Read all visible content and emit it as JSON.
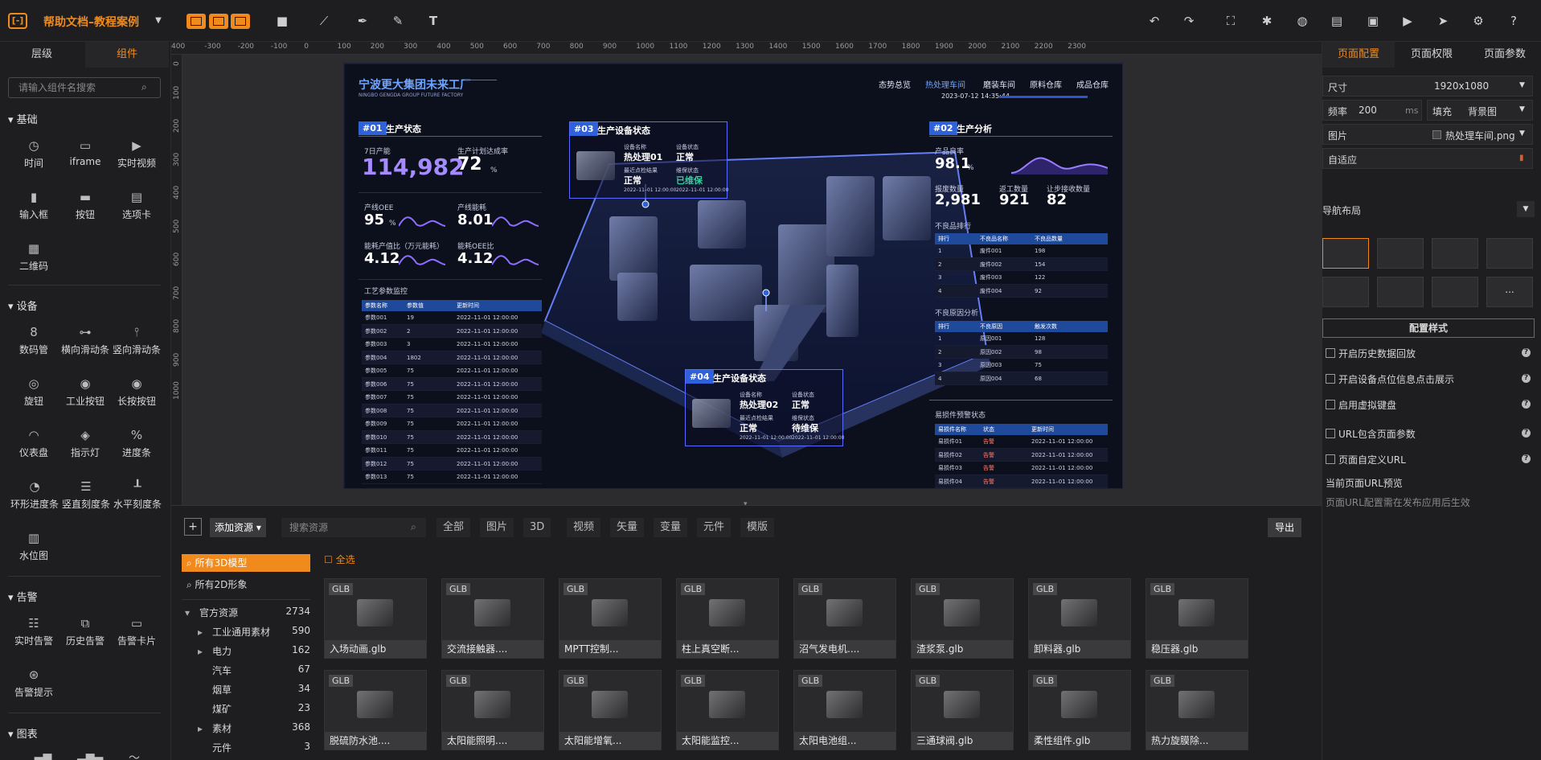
{
  "app": {
    "title": "帮助文档–教程案例",
    "logo_glyph": "[-]"
  },
  "toolbar": {
    "left_icons": [
      "layout-left-icon",
      "layout-center-icon",
      "layout-bottom-icon",
      "rectangle-tool-icon",
      "line-tool-icon",
      "pen-tool-icon",
      "brush-tool-icon",
      "text-tool-icon"
    ],
    "right_icons": [
      "undo-icon",
      "redo-icon",
      "fullscreen-icon",
      "bug-icon",
      "globe-icon",
      "document-icon",
      "save-icon",
      "play-icon",
      "send-icon",
      "gear-icon",
      "help-icon"
    ]
  },
  "left_panel": {
    "tabs": [
      "层级",
      "组件"
    ],
    "search_placeholder": "请输入组件名搜索",
    "sections": [
      {
        "title": "基础",
        "items": [
          "时间",
          "iframe",
          "实时视频",
          "输入框",
          "按钮",
          "选项卡",
          "二维码"
        ]
      },
      {
        "title": "设备",
        "items": [
          "数码管",
          "横向滑动条",
          "竖向滑动条",
          "旋钮",
          "工业按钮",
          "长按按钮",
          "仪表盘",
          "指示灯",
          "进度条",
          "环形进度条",
          "竖直刻度条",
          "水平刻度条",
          "水位图"
        ]
      },
      {
        "title": "告警",
        "items": [
          "实时告警",
          "历史告警",
          "告警卡片",
          "告警提示"
        ]
      },
      {
        "title": "图表",
        "items": []
      }
    ]
  },
  "ruler": {
    "h_labels": [
      "400",
      "-300",
      "-200",
      "-100",
      "0",
      "100",
      "200",
      "300",
      "400",
      "500",
      "600",
      "700",
      "800",
      "900",
      "1000",
      "1100",
      "1200",
      "1300",
      "1400",
      "1500",
      "1600",
      "1700",
      "1800",
      "1900",
      "2000",
      "2100",
      "2200",
      "2300"
    ],
    "v_labels": [
      "0",
      "100",
      "200",
      "300",
      "400",
      "500",
      "600",
      "700",
      "800",
      "900",
      "1000"
    ]
  },
  "dashboard": {
    "title": "宁波更大集团未来工厂",
    "subtitle": "NINGBO GENGDA GROUP FUTURE FACTORY",
    "nav": [
      "态势总览",
      "热处理车间",
      "磨装车间",
      "原料仓库",
      "成品仓库"
    ],
    "datetime": "2023-07-12 14:35:44",
    "p01": {
      "badge": "#01",
      "title": "生产状态",
      "kpi1_label": "7日产能",
      "kpi1_value": "114,982",
      "kpi2_label": "生产计划达成率",
      "kpi2_value": "72",
      "kpi2_unit": "%",
      "m1_label": "产线OEE",
      "m1_value": "95",
      "m1_unit": "%",
      "m2_label": "产线能耗",
      "m2_value": "8.01",
      "m3_label": "能耗产值比（万元能耗）",
      "m3_value": "4.12",
      "m4_label": "能耗OEE比",
      "m4_value": "4.12",
      "table_title": "工艺参数监控",
      "table_headers": [
        "参数名称",
        "参数值",
        "更新时间"
      ],
      "table_rows": [
        [
          "参数001",
          "19",
          "2022–11–01 12:00:00"
        ],
        [
          "参数002",
          "2",
          "2022–11–01 12:00:00"
        ],
        [
          "参数003",
          "3",
          "2022–11–01 12:00:00"
        ],
        [
          "参数004",
          "1802",
          "2022–11–01 12:00:00"
        ],
        [
          "参数005",
          "75",
          "2022–11–01 12:00:00"
        ],
        [
          "参数006",
          "75",
          "2022–11–01 12:00:00"
        ],
        [
          "参数007",
          "75",
          "2022–11–01 12:00:00"
        ],
        [
          "参数008",
          "75",
          "2022–11–01 12:00:00"
        ],
        [
          "参数009",
          "75",
          "2022–11–01 12:00:00"
        ],
        [
          "参数010",
          "75",
          "2022–11–01 12:00:00"
        ],
        [
          "参数011",
          "75",
          "2022–11–01 12:00:00"
        ],
        [
          "参数012",
          "75",
          "2022–11–01 12:00:00"
        ],
        [
          "参数013",
          "75",
          "2022–11–01 12:00:00"
        ]
      ]
    },
    "p03": {
      "badge": "#03",
      "title": "生产设备状态",
      "name_label": "设备名称",
      "name_value": "热处理01",
      "status_label": "设备状态",
      "status_value": "正常",
      "check_label": "最近点检结果",
      "check_value": "正常",
      "maint_label": "维保状态",
      "maint_value": "已维保",
      "time1": "2022–11–01 12:00:00",
      "time2": "2022–11–01 12:00:00"
    },
    "p04": {
      "badge": "#04",
      "title": "生产设备状态",
      "name_label": "设备名称",
      "name_value": "热处理02",
      "status_label": "设备状态",
      "status_value": "正常",
      "check_label": "最近点检结果",
      "check_value": "正常",
      "maint_label": "维保状态",
      "maint_value": "待维保",
      "time1": "2022–11–01 12:00:00",
      "time2": "2022–11–01 12:00:00"
    },
    "p02": {
      "badge": "#02",
      "title": "生产分析",
      "rate_label": "产品良率",
      "rate_value": "98.1",
      "rate_unit": "%",
      "c1_label": "报废数量",
      "c1_value": "2,981",
      "c2_label": "返工数量",
      "c2_value": "921",
      "c3_label": "让步接收数量",
      "c3_value": "82",
      "rank_title": "不良品排行",
      "rank_headers": [
        "排行",
        "不良品名称",
        "不良品数量"
      ],
      "rank_rows": [
        [
          "1",
          "废件001",
          "198"
        ],
        [
          "2",
          "废件002",
          "154"
        ],
        [
          "3",
          "废件003",
          "122"
        ],
        [
          "4",
          "废件004",
          "92"
        ]
      ],
      "cause_title": "不良原因分析",
      "cause_headers": [
        "排行",
        "不良原因",
        "触发次数"
      ],
      "cause_rows": [
        [
          "1",
          "原因001",
          "128"
        ],
        [
          "2",
          "原因002",
          "98"
        ],
        [
          "3",
          "原因003",
          "75"
        ],
        [
          "4",
          "原因004",
          "68"
        ]
      ],
      "alarm_title": "易损件预警状态",
      "alarm_headers": [
        "易损件名称",
        "状态",
        "更新时间"
      ],
      "alarm_rows": [
        [
          "易损件01",
          "告警",
          "2022–11–01 12:00:00"
        ],
        [
          "易损件02",
          "告警",
          "2022–11–01 12:00:00"
        ],
        [
          "易损件03",
          "告警",
          "2022–11–01 12:00:00"
        ],
        [
          "易损件04",
          "告警",
          "2022–11–01 12:00:00"
        ]
      ]
    }
  },
  "bottom": {
    "add_resource": "添加资源",
    "search_placeholder": "搜索资源",
    "filter_tabs": [
      "全部",
      "图片",
      "3D",
      "视频",
      "矢量",
      "变量",
      "元件",
      "模版"
    ],
    "export": "导出",
    "quick": [
      "所有3D模型",
      "所有2D形象"
    ],
    "tree": [
      {
        "label": "官方资源",
        "count": "2734",
        "level": 0,
        "expand": "▾"
      },
      {
        "label": "工业通用素材",
        "count": "590",
        "level": 1,
        "expand": "▸"
      },
      {
        "label": "电力",
        "count": "162",
        "level": 1,
        "expand": "▸"
      },
      {
        "label": "汽车",
        "count": "67",
        "level": 1,
        "expand": ""
      },
      {
        "label": "烟草",
        "count": "34",
        "level": 1,
        "expand": ""
      },
      {
        "label": "煤矿",
        "count": "23",
        "level": 1,
        "expand": ""
      },
      {
        "label": "素材",
        "count": "368",
        "level": 1,
        "expand": "▸"
      },
      {
        "label": "元件",
        "count": "3",
        "level": 1,
        "expand": ""
      }
    ],
    "select_all": "全选",
    "asset_tag": "GLB",
    "assets": [
      "入场动画.glb",
      "交流接触器....",
      "MPTT控制...",
      "柱上真空断...",
      "沼气发电机....",
      "渣浆泵.glb",
      "卸料器.glb",
      "稳压器.glb",
      "脱硫防水池....",
      "太阳能照明....",
      "太阳能增氧...",
      "太阳能监控...",
      "太阳电池组...",
      "三通球阀.glb",
      "柔性组件.glb",
      "热力旋膜除..."
    ]
  },
  "right_panel": {
    "tabs": [
      "页面配置",
      "页面权限",
      "页面参数"
    ],
    "size_label": "尺寸",
    "size_value": "1920x1080",
    "freq_label": "频率",
    "freq_value": "200",
    "freq_unit": "ms",
    "fill_label": "填充",
    "fill_value": "背景图",
    "image_label": "图片",
    "image_value": "热处理车间.png",
    "adaptive_label": "自适应",
    "nav_layout_label": "导航布局",
    "more_label": "...",
    "config_style": "配置样式",
    "options": [
      "开启历史数据回放",
      "开启设备点位信息点击展示",
      "启用虚拟键盘",
      "URL包含页面参数",
      "页面自定义URL"
    ],
    "url_preview_label": "当前页面URL预览",
    "url_hint": "页面URL配置需在发布应用后生效"
  },
  "colors": {
    "accent": "#f08a1d",
    "dash_blue": "#2f61d9",
    "purple": "#a58bff"
  }
}
